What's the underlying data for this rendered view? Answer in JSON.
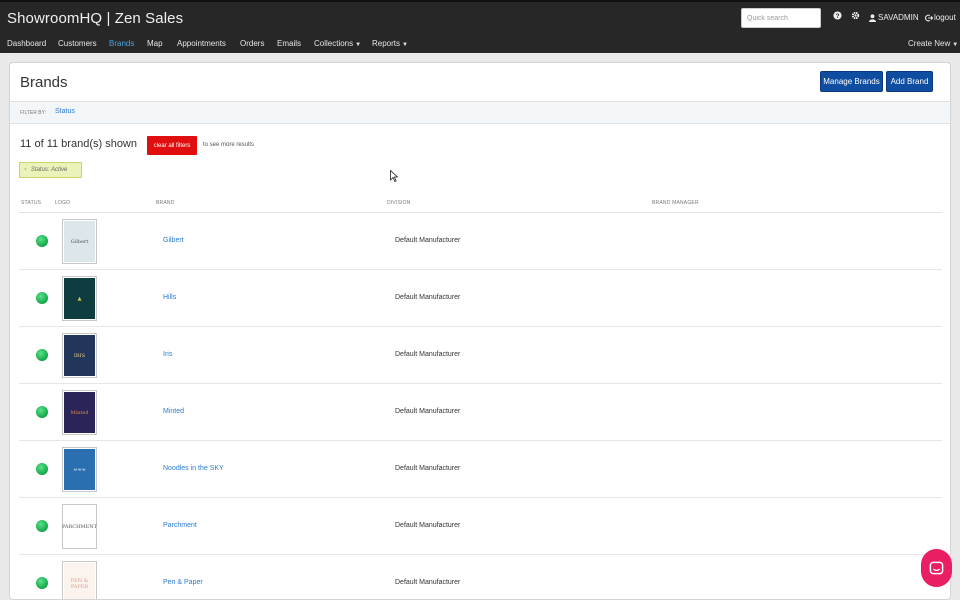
{
  "header": {
    "title": "ShowroomHQ | Zen Sales",
    "search_placeholder": "Quick search",
    "user": "SAVADMIN",
    "logout": "logout"
  },
  "nav": {
    "items": [
      {
        "label": "Dashboard",
        "active": false
      },
      {
        "label": "Customers",
        "active": false
      },
      {
        "label": "Brands",
        "active": true
      },
      {
        "label": "Map",
        "active": false
      },
      {
        "label": "Appointments",
        "active": false
      },
      {
        "label": "Orders",
        "active": false
      },
      {
        "label": "Emails",
        "active": false
      },
      {
        "label": "Collections",
        "active": false,
        "dropdown": true
      },
      {
        "label": "Reports",
        "active": false,
        "dropdown": true
      }
    ],
    "create_new": "Create New"
  },
  "page": {
    "title": "Brands",
    "manage_button": "Manage Brands",
    "add_button": "Add Brand"
  },
  "filter": {
    "label": "FILTER BY:",
    "link": "Status"
  },
  "results": {
    "count_text": "11 of 11 brand(s) shown",
    "clear_button": "clear all filters",
    "hint": "to see more results",
    "chip": "Status: Active"
  },
  "table": {
    "headers": [
      "STATUS",
      "LOGO",
      "BRAND",
      "DIVISION",
      "BRAND MANAGER"
    ],
    "rows": [
      {
        "brand": "Gilbert",
        "division": "Default Manufacturer",
        "manager": "",
        "status": "active",
        "logo_text": "Gilbert",
        "logo_bg": "#dde6ea",
        "logo_fg": "#4a5a66"
      },
      {
        "brand": "Hills",
        "division": "Default Manufacturer",
        "manager": "",
        "status": "active",
        "logo_text": "▲",
        "logo_bg": "#0d3d3e",
        "logo_fg": "#e0c25a"
      },
      {
        "brand": "Iris",
        "division": "Default Manufacturer",
        "manager": "",
        "status": "active",
        "logo_text": "IRIS",
        "logo_bg": "#22365c",
        "logo_fg": "#f1d28a"
      },
      {
        "brand": "Minted",
        "division": "Default Manufacturer",
        "manager": "",
        "status": "active",
        "logo_text": "Minted",
        "logo_bg": "#2b2458",
        "logo_fg": "#e0894a"
      },
      {
        "brand": "Noodles in the SKY",
        "division": "Default Manufacturer",
        "manager": "",
        "status": "active",
        "logo_text": "≈≈≈",
        "logo_bg": "#2a6fb0",
        "logo_fg": "#ffffff"
      },
      {
        "brand": "Parchment",
        "division": "Default Manufacturer",
        "manager": "",
        "status": "active",
        "logo_text": "PARCHMENT",
        "logo_bg": "#ffffff",
        "logo_fg": "#555555"
      },
      {
        "brand": "Pen & Paper",
        "division": "Default Manufacturer",
        "manager": "",
        "status": "active",
        "logo_text": "PEN & PAPER",
        "logo_bg": "#fbf3ee",
        "logo_fg": "#d7a08a"
      }
    ]
  },
  "colors": {
    "topbar": "#272727",
    "accent": "#0f4da1",
    "link": "#2a7ccf",
    "danger": "#e00e0e",
    "status_active": "#15a548",
    "chat": "#e91e63"
  }
}
